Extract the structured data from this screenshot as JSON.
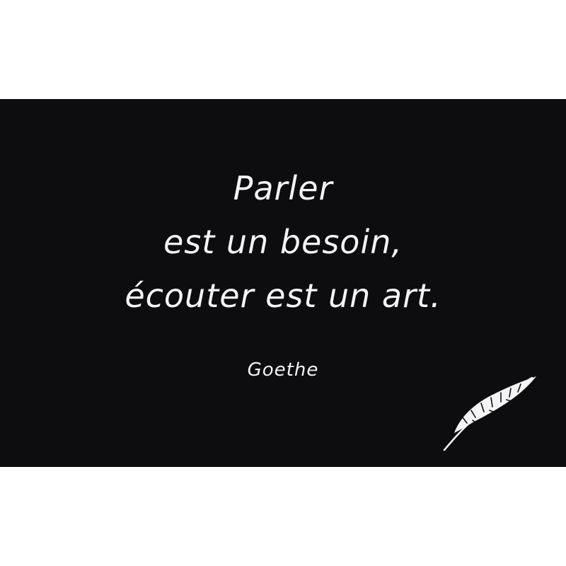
{
  "quote": {
    "line1": "Parler",
    "line2": "est un besoin,",
    "line3": "écouter est un art."
  },
  "author": "Goethe",
  "icons": {
    "feather": "feather-quill-icon"
  },
  "colors": {
    "background": "#0d0d0f",
    "text": "#f4f4f4"
  }
}
